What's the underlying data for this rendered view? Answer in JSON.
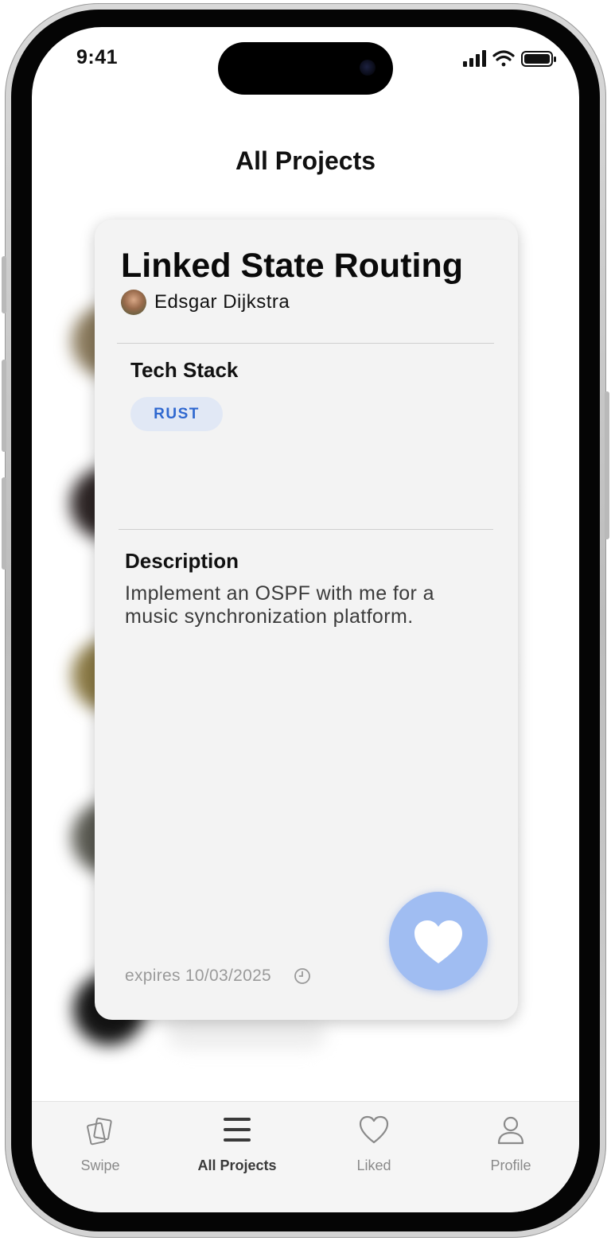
{
  "status_bar": {
    "time": "9:41",
    "icons": [
      "signal-icon",
      "wifi-icon",
      "battery-icon"
    ]
  },
  "header": {
    "title": "All Projects"
  },
  "project_card": {
    "title": "Linked State Routing",
    "author": "Edsgar Dijkstra",
    "tech_stack_heading": "Tech Stack",
    "tags": [
      "RUST"
    ],
    "description_heading": "Description",
    "description": "Implement an OSPF with me for a music synchronization platform.",
    "expires": "expires 10/03/2025",
    "like_icon": "heart-icon",
    "accent_color": "#a0bdf2",
    "tag_color": "#2f68d0"
  },
  "tab_bar": {
    "items": [
      {
        "label": "Swipe",
        "icon": "cards-icon",
        "active": false
      },
      {
        "label": "All Projects",
        "icon": "list-icon",
        "active": true
      },
      {
        "label": "Liked",
        "icon": "heart-outline-icon",
        "active": false
      },
      {
        "label": "Profile",
        "icon": "person-icon",
        "active": false
      }
    ]
  }
}
